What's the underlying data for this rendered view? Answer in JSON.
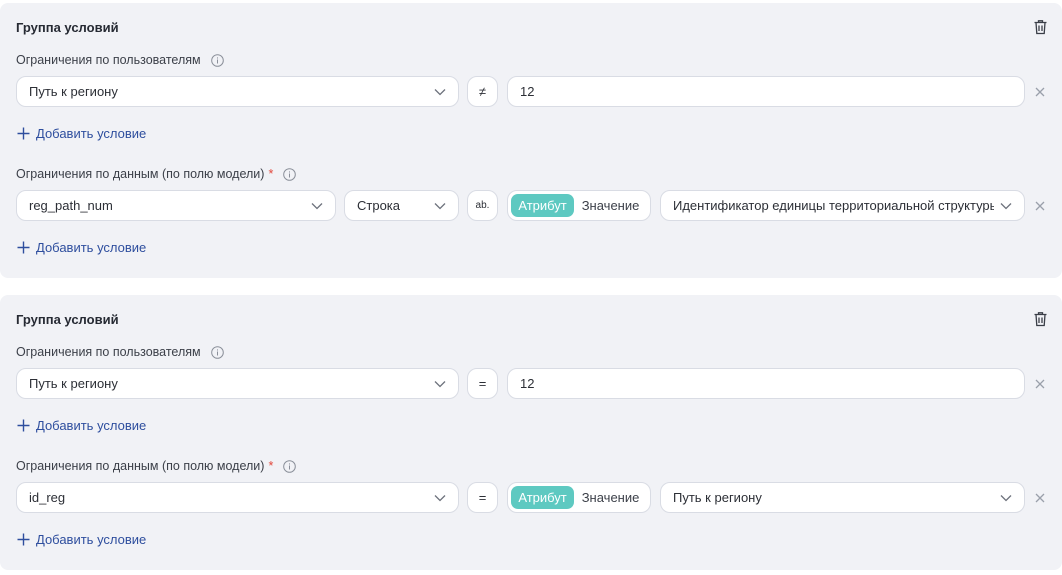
{
  "groups": [
    {
      "title": "Группа условий",
      "user_section": {
        "label": "Ограничения по пользователям",
        "condition": {
          "field": "Путь к региону",
          "operator": "≠",
          "value": "12"
        },
        "add_label": "Добавить условие"
      },
      "data_section": {
        "label": "Ограничения по данным (по полю модели)",
        "required_mark": "*",
        "condition": {
          "field": "reg_path_num",
          "type": "Строка",
          "operator": "ab.",
          "toggle": {
            "attribute": "Атрибут",
            "value": "Значение",
            "selected": "Атрибут"
          },
          "value": "Идентификатор единицы территориальной структуры"
        },
        "add_label": "Добавить условие"
      }
    },
    {
      "title": "Группа условий",
      "user_section": {
        "label": "Ограничения по пользователям",
        "condition": {
          "field": "Путь к региону",
          "operator": "=",
          "value": "12"
        },
        "add_label": "Добавить условие"
      },
      "data_section": {
        "label": "Ограничения по данным (по полю модели)",
        "required_mark": "*",
        "condition": {
          "field": "id_reg",
          "operator": "=",
          "toggle": {
            "attribute": "Атрибут",
            "value": "Значение",
            "selected": "Атрибут"
          },
          "value": "Путь к региону"
        },
        "add_label": "Добавить условие"
      }
    }
  ],
  "colors": {
    "panel": "#f1f2f6",
    "accent": "#5ec9c1",
    "link": "#2e4e9e",
    "required": "#e2463a"
  },
  "icons": {
    "delete": "trash-icon",
    "info": "info-icon",
    "dropdown": "chevron-down-icon",
    "clear": "close-icon",
    "add": "plus-icon"
  }
}
